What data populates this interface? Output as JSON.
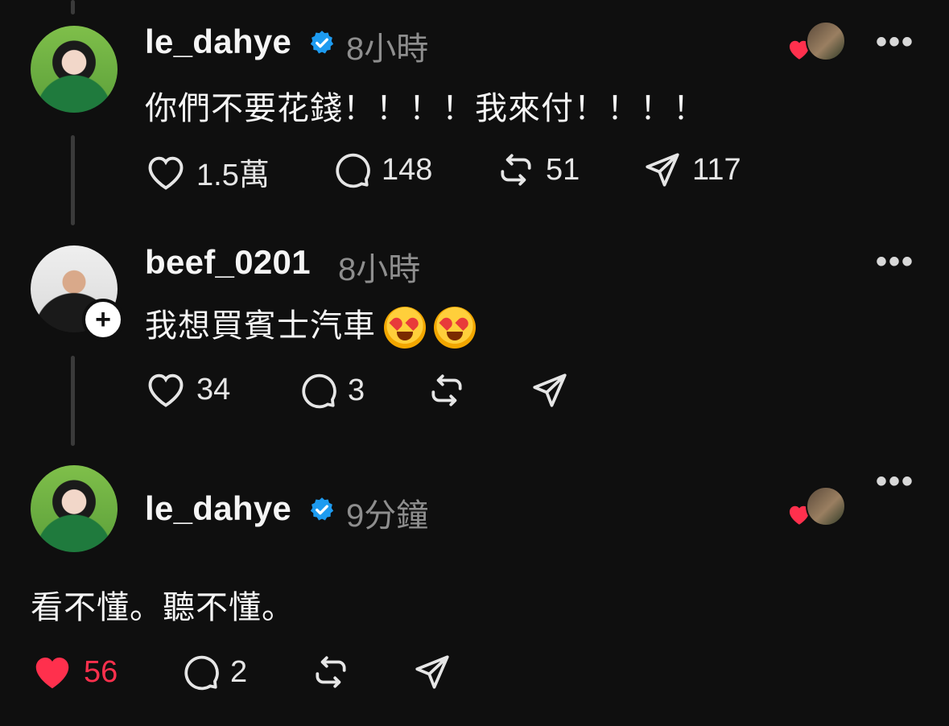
{
  "posts": [
    {
      "username": "le_dahye",
      "verified": true,
      "time": "8小時",
      "content": "你們不要花錢！！！！我來付！！！！",
      "likes": "1.5萬",
      "comments": "148",
      "reposts": "51",
      "shares": "117"
    },
    {
      "username": "beef_0201",
      "verified": false,
      "time": "8小時",
      "content": "我想買賓士汽車",
      "likes": "34",
      "comments": "3",
      "reposts": "",
      "shares": ""
    },
    {
      "username": "le_dahye",
      "verified": true,
      "time": "9分鐘",
      "content": "看不懂。聽不懂。",
      "likes": "56",
      "comments": "2",
      "reposts": "",
      "shares": ""
    }
  ],
  "icons": {
    "like": "heart-icon",
    "comment": "comment-icon",
    "repost": "repost-icon",
    "share": "send-icon",
    "more": "more-icon",
    "verified": "verified-badge-icon",
    "follow": "plus-icon"
  },
  "colors": {
    "background": "#0f0f0f",
    "text": "#f5f5f5",
    "muted": "#8e8e8e",
    "liked": "#ff304d",
    "verified": "#1d9bf0"
  }
}
